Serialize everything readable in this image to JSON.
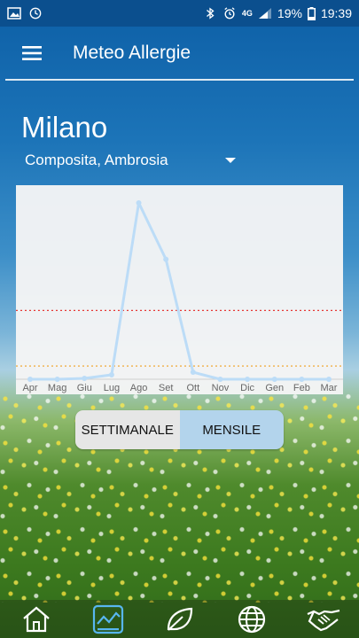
{
  "status_bar": {
    "battery": "19%",
    "time": "19:39",
    "network": "4G"
  },
  "app": {
    "title": "Meteo Allergie"
  },
  "location": {
    "city": "Milano",
    "allergen": "Composita, Ambrosia"
  },
  "chart_data": {
    "type": "line",
    "categories": [
      "Apr",
      "Mag",
      "Giu",
      "Lug",
      "Ago",
      "Set",
      "Ott",
      "Nov",
      "Dic",
      "Gen",
      "Feb",
      "Mar"
    ],
    "values": [
      0,
      0,
      0.5,
      2.5,
      100,
      68,
      4,
      0,
      0,
      0,
      0,
      0
    ],
    "ylim": [
      0,
      105
    ],
    "thresholds": [
      {
        "value": 39,
        "color": "#e53935"
      },
      {
        "value": 7.5,
        "color": "#f0a020"
      }
    ],
    "line_color": "#bcdcf7",
    "grid": false,
    "title": "",
    "xlabel": "",
    "ylabel": ""
  },
  "toggle": {
    "weekly": "SETTIMANALE",
    "monthly": "MENSILE",
    "selected": "monthly"
  },
  "nav": [
    {
      "icon": "home-icon"
    },
    {
      "icon": "chart-icon"
    },
    {
      "icon": "leaf-icon"
    },
    {
      "icon": "globe-icon"
    },
    {
      "icon": "handshake-icon"
    }
  ]
}
